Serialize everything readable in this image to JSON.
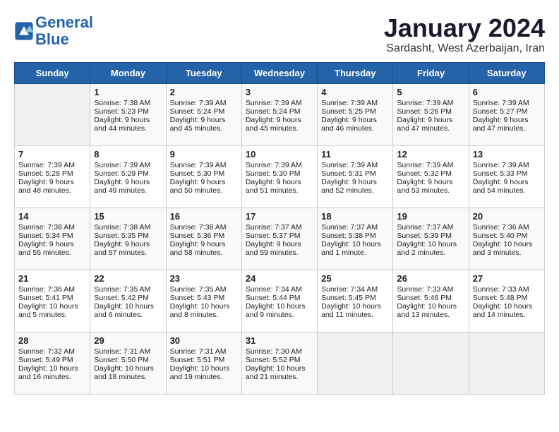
{
  "header": {
    "logo_line1": "General",
    "logo_line2": "Blue",
    "month": "January 2024",
    "location": "Sardasht, West Azerbaijan, Iran"
  },
  "weekdays": [
    "Sunday",
    "Monday",
    "Tuesday",
    "Wednesday",
    "Thursday",
    "Friday",
    "Saturday"
  ],
  "weeks": [
    [
      {
        "day": "",
        "sunrise": "",
        "sunset": "",
        "daylight": ""
      },
      {
        "day": "1",
        "sunrise": "Sunrise: 7:38 AM",
        "sunset": "Sunset: 5:23 PM",
        "daylight": "Daylight: 9 hours and 44 minutes."
      },
      {
        "day": "2",
        "sunrise": "Sunrise: 7:39 AM",
        "sunset": "Sunset: 5:24 PM",
        "daylight": "Daylight: 9 hours and 45 minutes."
      },
      {
        "day": "3",
        "sunrise": "Sunrise: 7:39 AM",
        "sunset": "Sunset: 5:24 PM",
        "daylight": "Daylight: 9 hours and 45 minutes."
      },
      {
        "day": "4",
        "sunrise": "Sunrise: 7:39 AM",
        "sunset": "Sunset: 5:25 PM",
        "daylight": "Daylight: 9 hours and 46 minutes."
      },
      {
        "day": "5",
        "sunrise": "Sunrise: 7:39 AM",
        "sunset": "Sunset: 5:26 PM",
        "daylight": "Daylight: 9 hours and 47 minutes."
      },
      {
        "day": "6",
        "sunrise": "Sunrise: 7:39 AM",
        "sunset": "Sunset: 5:27 PM",
        "daylight": "Daylight: 9 hours and 47 minutes."
      }
    ],
    [
      {
        "day": "7",
        "sunrise": "Sunrise: 7:39 AM",
        "sunset": "Sunset: 5:28 PM",
        "daylight": "Daylight: 9 hours and 48 minutes."
      },
      {
        "day": "8",
        "sunrise": "Sunrise: 7:39 AM",
        "sunset": "Sunset: 5:29 PM",
        "daylight": "Daylight: 9 hours and 49 minutes."
      },
      {
        "day": "9",
        "sunrise": "Sunrise: 7:39 AM",
        "sunset": "Sunset: 5:30 PM",
        "daylight": "Daylight: 9 hours and 50 minutes."
      },
      {
        "day": "10",
        "sunrise": "Sunrise: 7:39 AM",
        "sunset": "Sunset: 5:30 PM",
        "daylight": "Daylight: 9 hours and 51 minutes."
      },
      {
        "day": "11",
        "sunrise": "Sunrise: 7:39 AM",
        "sunset": "Sunset: 5:31 PM",
        "daylight": "Daylight: 9 hours and 52 minutes."
      },
      {
        "day": "12",
        "sunrise": "Sunrise: 7:39 AM",
        "sunset": "Sunset: 5:32 PM",
        "daylight": "Daylight: 9 hours and 53 minutes."
      },
      {
        "day": "13",
        "sunrise": "Sunrise: 7:39 AM",
        "sunset": "Sunset: 5:33 PM",
        "daylight": "Daylight: 9 hours and 54 minutes."
      }
    ],
    [
      {
        "day": "14",
        "sunrise": "Sunrise: 7:38 AM",
        "sunset": "Sunset: 5:34 PM",
        "daylight": "Daylight: 9 hours and 55 minutes."
      },
      {
        "day": "15",
        "sunrise": "Sunrise: 7:38 AM",
        "sunset": "Sunset: 5:35 PM",
        "daylight": "Daylight: 9 hours and 57 minutes."
      },
      {
        "day": "16",
        "sunrise": "Sunrise: 7:38 AM",
        "sunset": "Sunset: 5:36 PM",
        "daylight": "Daylight: 9 hours and 58 minutes."
      },
      {
        "day": "17",
        "sunrise": "Sunrise: 7:37 AM",
        "sunset": "Sunset: 5:37 PM",
        "daylight": "Daylight: 9 hours and 59 minutes."
      },
      {
        "day": "18",
        "sunrise": "Sunrise: 7:37 AM",
        "sunset": "Sunset: 5:38 PM",
        "daylight": "Daylight: 10 hours and 1 minute."
      },
      {
        "day": "19",
        "sunrise": "Sunrise: 7:37 AM",
        "sunset": "Sunset: 5:39 PM",
        "daylight": "Daylight: 10 hours and 2 minutes."
      },
      {
        "day": "20",
        "sunrise": "Sunrise: 7:36 AM",
        "sunset": "Sunset: 5:40 PM",
        "daylight": "Daylight: 10 hours and 3 minutes."
      }
    ],
    [
      {
        "day": "21",
        "sunrise": "Sunrise: 7:36 AM",
        "sunset": "Sunset: 5:41 PM",
        "daylight": "Daylight: 10 hours and 5 minutes."
      },
      {
        "day": "22",
        "sunrise": "Sunrise: 7:35 AM",
        "sunset": "Sunset: 5:42 PM",
        "daylight": "Daylight: 10 hours and 6 minutes."
      },
      {
        "day": "23",
        "sunrise": "Sunrise: 7:35 AM",
        "sunset": "Sunset: 5:43 PM",
        "daylight": "Daylight: 10 hours and 8 minutes."
      },
      {
        "day": "24",
        "sunrise": "Sunrise: 7:34 AM",
        "sunset": "Sunset: 5:44 PM",
        "daylight": "Daylight: 10 hours and 9 minutes."
      },
      {
        "day": "25",
        "sunrise": "Sunrise: 7:34 AM",
        "sunset": "Sunset: 5:45 PM",
        "daylight": "Daylight: 10 hours and 11 minutes."
      },
      {
        "day": "26",
        "sunrise": "Sunrise: 7:33 AM",
        "sunset": "Sunset: 5:46 PM",
        "daylight": "Daylight: 10 hours and 13 minutes."
      },
      {
        "day": "27",
        "sunrise": "Sunrise: 7:33 AM",
        "sunset": "Sunset: 5:48 PM",
        "daylight": "Daylight: 10 hours and 14 minutes."
      }
    ],
    [
      {
        "day": "28",
        "sunrise": "Sunrise: 7:32 AM",
        "sunset": "Sunset: 5:49 PM",
        "daylight": "Daylight: 10 hours and 16 minutes."
      },
      {
        "day": "29",
        "sunrise": "Sunrise: 7:31 AM",
        "sunset": "Sunset: 5:50 PM",
        "daylight": "Daylight: 10 hours and 18 minutes."
      },
      {
        "day": "30",
        "sunrise": "Sunrise: 7:31 AM",
        "sunset": "Sunset: 5:51 PM",
        "daylight": "Daylight: 10 hours and 19 minutes."
      },
      {
        "day": "31",
        "sunrise": "Sunrise: 7:30 AM",
        "sunset": "Sunset: 5:52 PM",
        "daylight": "Daylight: 10 hours and 21 minutes."
      },
      {
        "day": "",
        "sunrise": "",
        "sunset": "",
        "daylight": ""
      },
      {
        "day": "",
        "sunrise": "",
        "sunset": "",
        "daylight": ""
      },
      {
        "day": "",
        "sunrise": "",
        "sunset": "",
        "daylight": ""
      }
    ]
  ]
}
